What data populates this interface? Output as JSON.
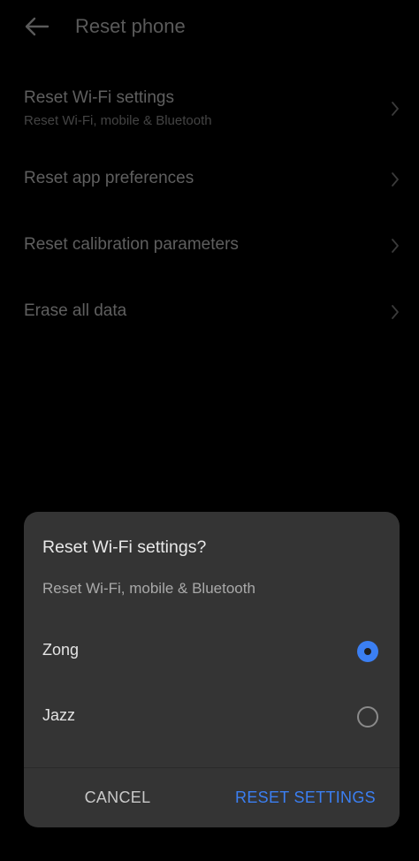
{
  "header": {
    "title": "Reset phone",
    "back_icon": "arrow-left-icon"
  },
  "settings": {
    "items": [
      {
        "title": "Reset Wi-Fi settings",
        "subtitle": "Reset Wi-Fi, mobile & Bluetooth"
      },
      {
        "title": "Reset app preferences",
        "subtitle": ""
      },
      {
        "title": "Reset calibration parameters",
        "subtitle": ""
      },
      {
        "title": "Erase all data",
        "subtitle": ""
      }
    ]
  },
  "dialog": {
    "title": "Reset Wi-Fi settings?",
    "subtitle": "Reset Wi-Fi, mobile & Bluetooth",
    "options": [
      {
        "label": "Zong",
        "selected": true
      },
      {
        "label": "Jazz",
        "selected": false
      }
    ],
    "cancel_label": "CANCEL",
    "confirm_label": "RESET SETTINGS"
  },
  "colors": {
    "accent": "#3b7ff2",
    "dialog_bg": "#343434",
    "background": "#000000"
  }
}
